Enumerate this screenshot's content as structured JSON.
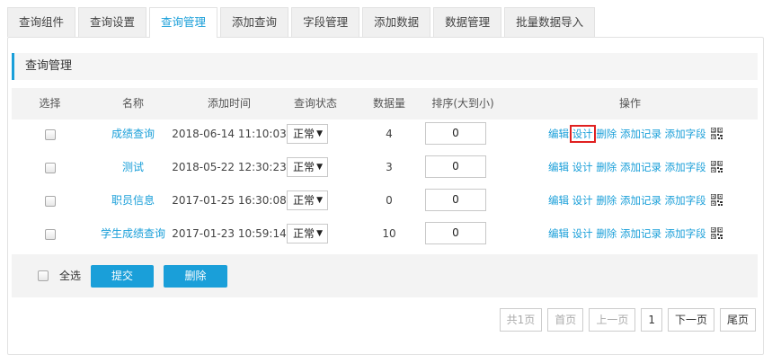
{
  "tabs": [
    {
      "label": "查询组件"
    },
    {
      "label": "查询设置"
    },
    {
      "label": "查询管理"
    },
    {
      "label": "添加查询"
    },
    {
      "label": "字段管理"
    },
    {
      "label": "添加数据"
    },
    {
      "label": "数据管理"
    },
    {
      "label": "批量数据导入"
    }
  ],
  "active_tab": "查询管理",
  "section_title": "查询管理",
  "table": {
    "headers": {
      "select": "选择",
      "name": "名称",
      "time": "添加时间",
      "status": "查询状态",
      "count": "数据量",
      "sort": "排序(大到小)",
      "ops": "操作"
    },
    "rows": [
      {
        "name": "成绩查询",
        "time": "2018-06-14 11:10:03",
        "status": "正常",
        "count": "4",
        "sort": "0",
        "checked": false
      },
      {
        "name": "测试",
        "time": "2018-05-22 12:30:23",
        "status": "正常",
        "count": "3",
        "sort": "0",
        "checked": false
      },
      {
        "name": "职员信息",
        "time": "2017-01-25 16:30:08",
        "status": "正常",
        "count": "0",
        "sort": "0",
        "checked": false
      },
      {
        "name": "学生成绩查询",
        "time": "2017-01-23 10:59:14",
        "status": "正常",
        "count": "10",
        "sort": "0",
        "checked": false
      }
    ],
    "actions": {
      "edit": "编辑",
      "design": "设计",
      "delete": "删除",
      "add_record": "添加记录",
      "add_field": "添加字段",
      "qr_icon": "qr-code-icon"
    }
  },
  "footer": {
    "select_all": "全选",
    "submit": "提交",
    "delete": "删除"
  },
  "pagination": {
    "total": "共1页",
    "first": "首页",
    "prev": "上一页",
    "current": "1",
    "next": "下一页",
    "last": "尾页"
  },
  "colors": {
    "accent": "#1a9fd9",
    "highlight_box": "#e02020"
  }
}
